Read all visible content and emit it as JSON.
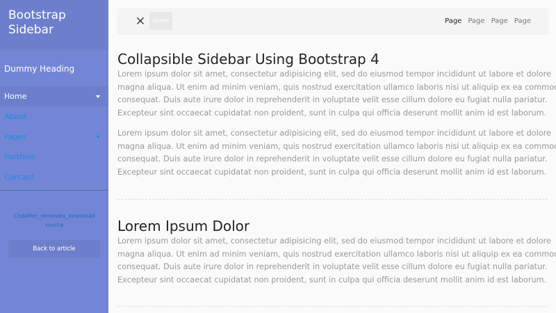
{
  "sidebar": {
    "title_line1": "Bootstrap",
    "title_line2": "Sidebar",
    "dummy_heading": "Dummy Heading",
    "items": [
      {
        "label": "Home"
      },
      {
        "label": "About"
      },
      {
        "label": "Pages"
      },
      {
        "label": "Portfolio"
      },
      {
        "label": "Contact"
      }
    ],
    "download_line1": "CodePen_removed_download",
    "download_line2": "source",
    "back_label": "Back to article"
  },
  "navbar": {
    "home_chip": "Home",
    "links": [
      "Page",
      "Page",
      "Page",
      "Page"
    ]
  },
  "main": {
    "heading1": "Collapsible Sidebar Using Bootstrap 4",
    "heading2": "Lorem Ipsum Dolor",
    "para_lines": [
      "Lorem ipsum dolor sit amet, consectetur adipisicing elit, sed do eiusmod tempor incididunt ut labore et dolore",
      "magna aliqua. Ut enim ad minim veniam, quis nostrud exercitation ullamco laboris nisi ut aliquip ex ea commodo",
      "consequat. Duis aute irure dolor in reprehenderit in voluptate velit esse cillum dolore eu fugiat nulla pariatur.",
      "Excepteur sint occaecat cupidatat non proident, sunt in culpa qui officia deserunt mollit anim id est laborum."
    ]
  },
  "colors": {
    "sidebar_bg": "#7386d5",
    "sidebar_header_bg": "#6d7fcc",
    "link_blue": "#1e8ae6"
  },
  "icons": {
    "toggle": "close-icon",
    "dropdown": "caret-down-icon"
  }
}
